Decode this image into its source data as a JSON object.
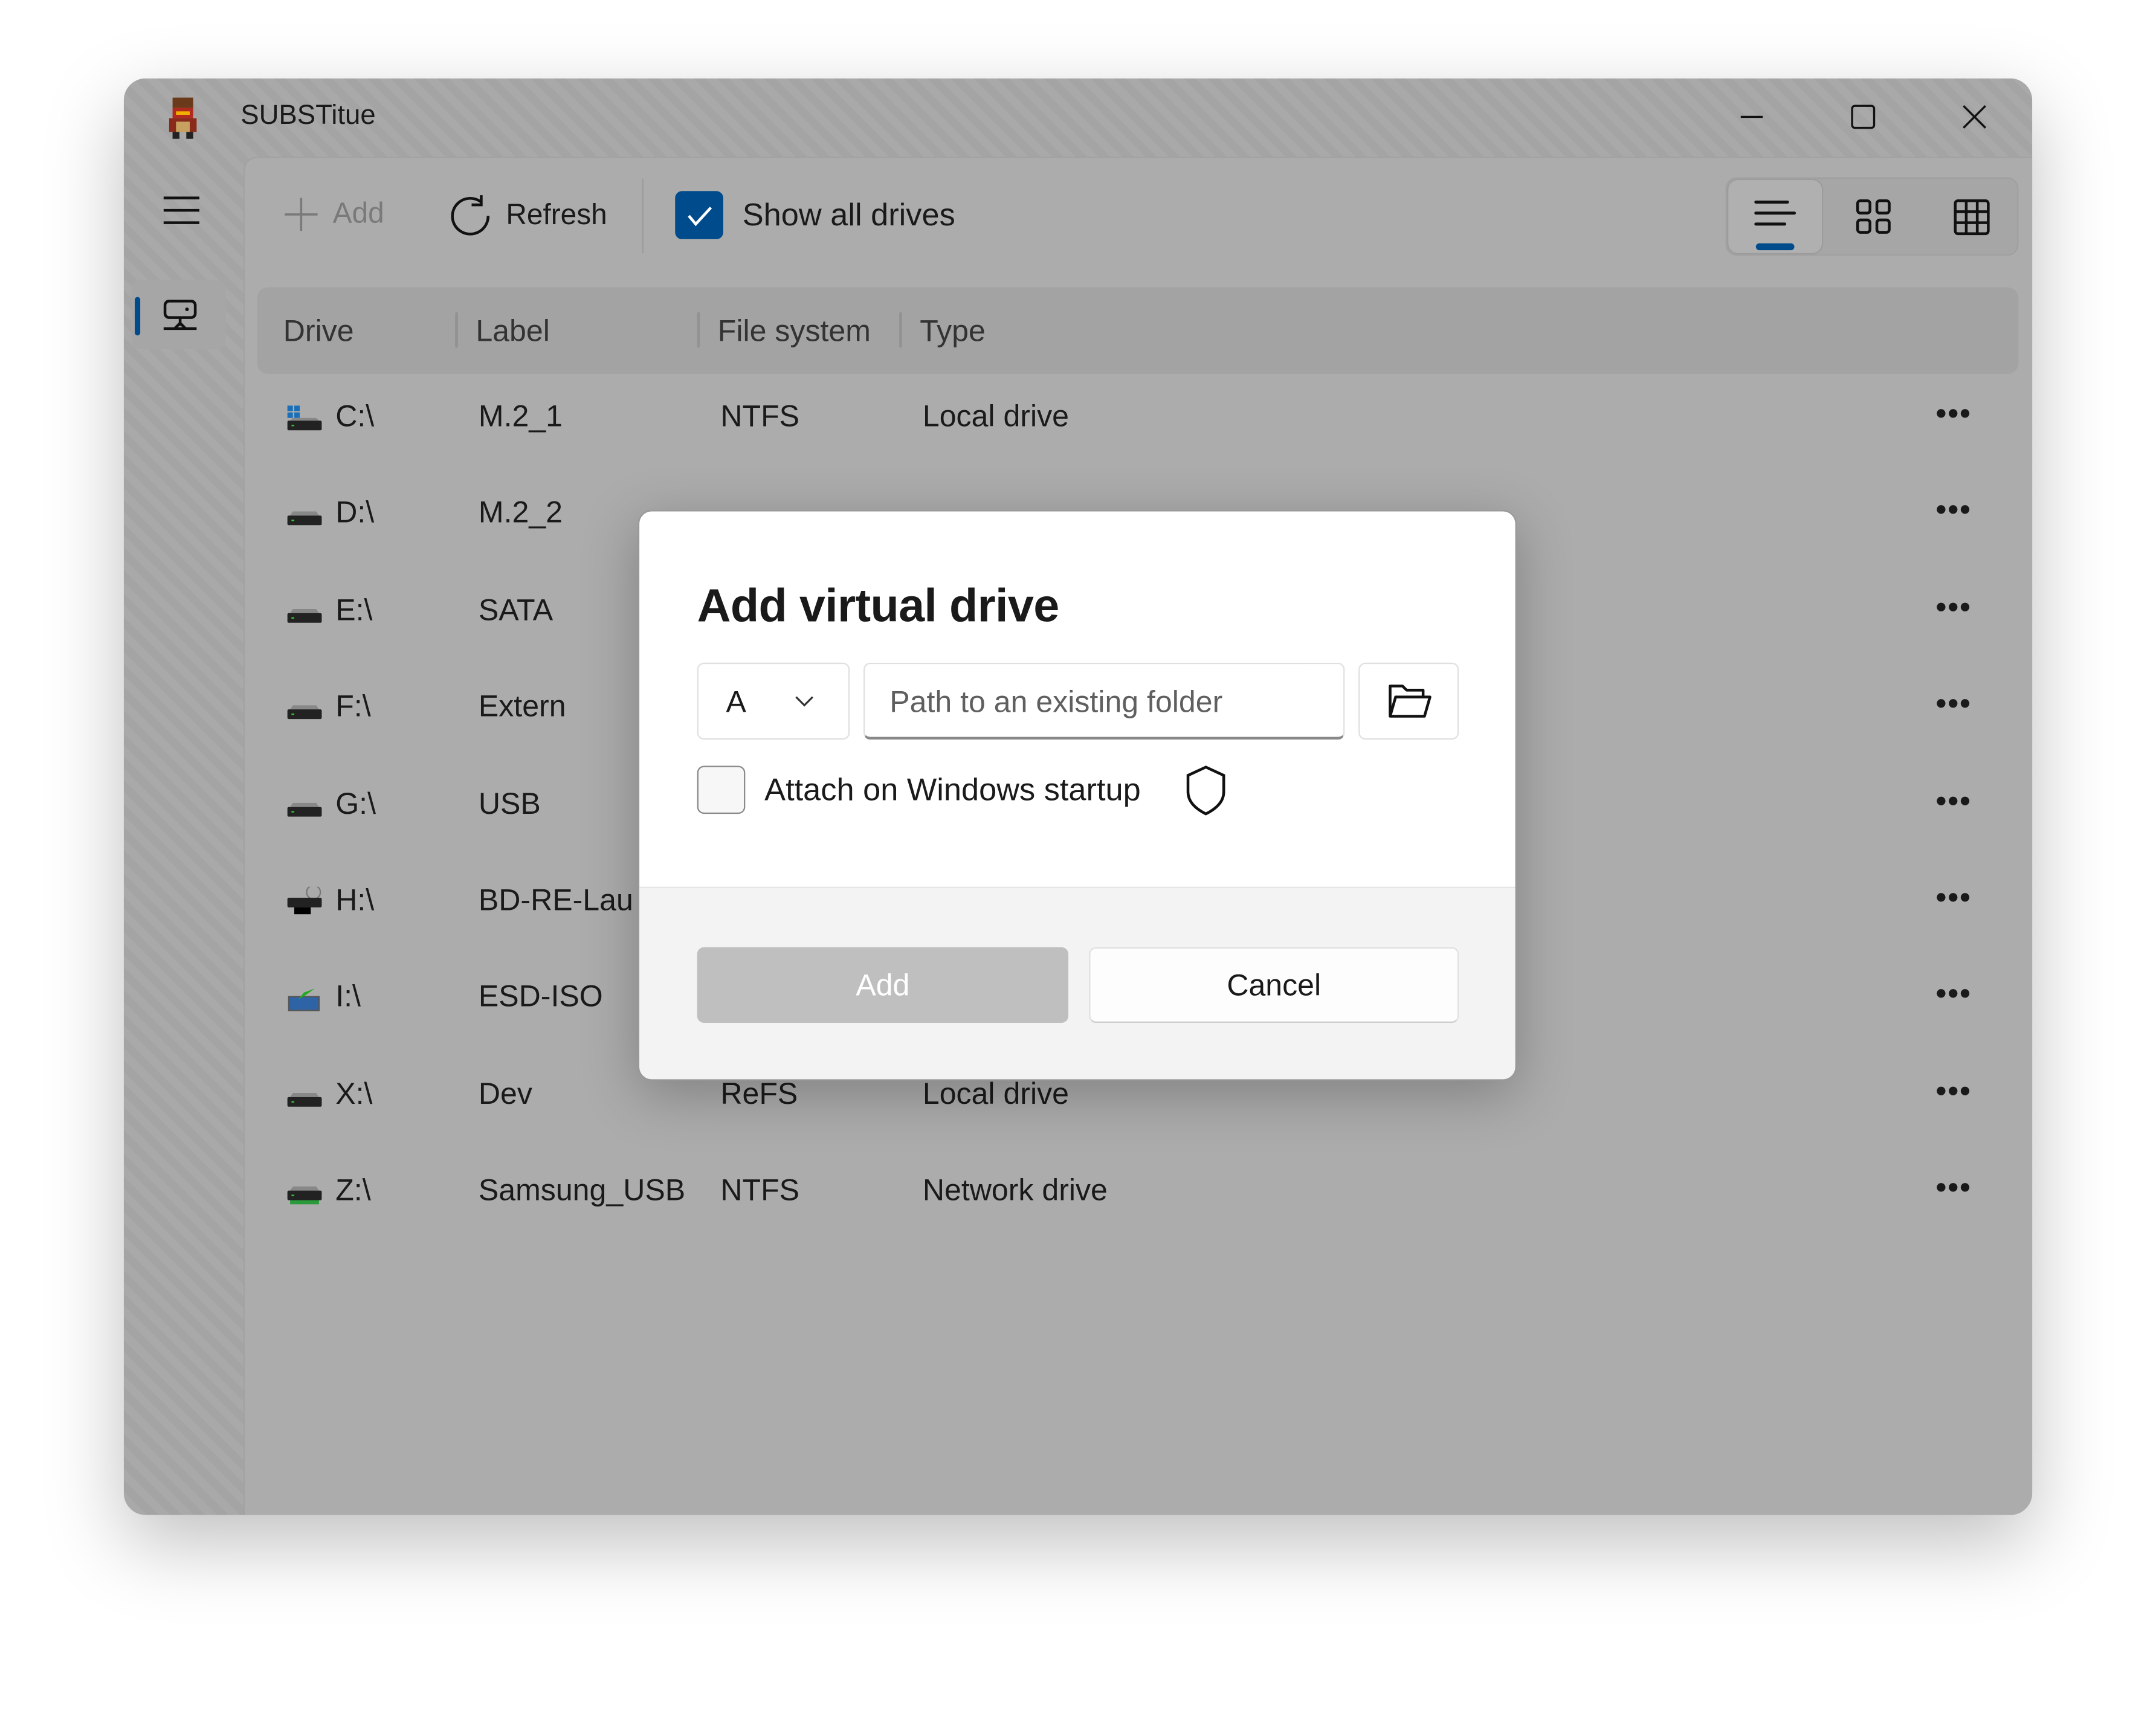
{
  "window": {
    "title": "SUBSTitue",
    "icon": "pixel-character-icon"
  },
  "toolbar": {
    "add_label": "Add",
    "refresh_label": "Refresh",
    "show_all_drives_label": "Show all drives",
    "show_all_drives_checked": true,
    "view_modes": [
      "list",
      "tiles",
      "grid"
    ],
    "active_view": "list"
  },
  "table": {
    "columns": [
      "Drive",
      "Label",
      "File system",
      "Type"
    ],
    "rows": [
      {
        "drive": "C:\\",
        "label": "M.2_1",
        "fs": "NTFS",
        "type": "Local drive",
        "icon": "system-drive-icon"
      },
      {
        "drive": "D:\\",
        "label": "M.2_2",
        "fs": "",
        "type": "",
        "icon": "hard-drive-icon"
      },
      {
        "drive": "E:\\",
        "label": "SATA",
        "fs": "",
        "type": "",
        "icon": "hard-drive-icon"
      },
      {
        "drive": "F:\\",
        "label": "Extern",
        "fs": "",
        "type": "",
        "icon": "hard-drive-icon"
      },
      {
        "drive": "G:\\",
        "label": "USB",
        "fs": "",
        "type": "",
        "icon": "hard-drive-icon"
      },
      {
        "drive": "H:\\",
        "label": "BD-RE-Lau",
        "fs": "",
        "type": "",
        "icon": "bd-drive-icon"
      },
      {
        "drive": "I:\\",
        "label": "ESD-ISO",
        "fs": "",
        "type": "",
        "icon": "iso-drive-icon"
      },
      {
        "drive": "X:\\",
        "label": "Dev",
        "fs": "ReFS",
        "type": "Local drive",
        "icon": "hard-drive-icon"
      },
      {
        "drive": "Z:\\",
        "label": "Samsung_USB",
        "fs": "NTFS",
        "type": "Network drive",
        "icon": "network-drive-icon"
      }
    ],
    "more_label": "•••"
  },
  "dialog": {
    "title": "Add virtual drive",
    "drive_letter": "A",
    "path_placeholder": "Path to an existing folder",
    "path_value": "",
    "startup_label": "Attach on Windows startup",
    "startup_checked": false,
    "add_label": "Add",
    "cancel_label": "Cancel"
  },
  "colors": {
    "accent": "#004b8b"
  }
}
